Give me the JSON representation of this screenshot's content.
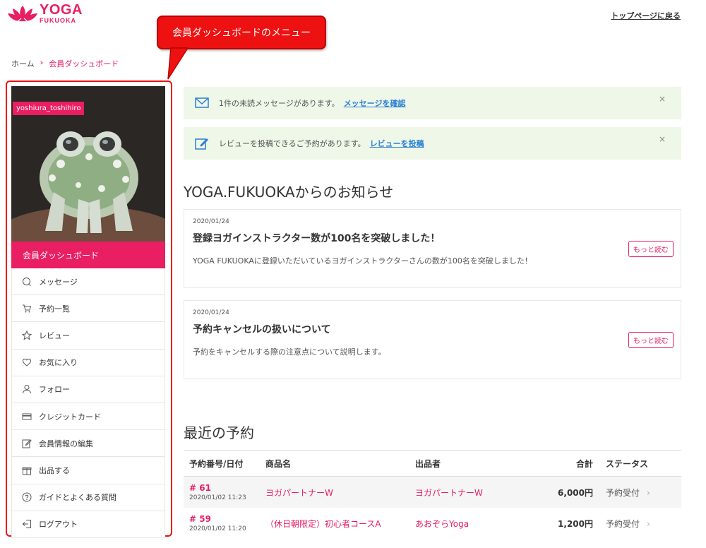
{
  "brand": {
    "name": "YOGA",
    "sub": "FUKUOKA",
    "accent": "#e91e63"
  },
  "header": {
    "back_link": "トップページに戻る"
  },
  "callout": {
    "text": "会員ダッシュボードのメニュー"
  },
  "breadcrumb": [
    "ホーム",
    "会員ダッシュボード"
  ],
  "sidebar": {
    "username": "yoshiura_toshihiro",
    "dashboard_label": "会員ダッシュボード",
    "items": [
      {
        "label": "メッセージ",
        "icon": "message-icon"
      },
      {
        "label": "予約一覧",
        "icon": "cart-icon"
      },
      {
        "label": "レビュー",
        "icon": "star-icon"
      },
      {
        "label": "お気に入り",
        "icon": "heart-icon"
      },
      {
        "label": "フォロー",
        "icon": "user-icon"
      },
      {
        "label": "クレジットカード",
        "icon": "credit-card-icon"
      },
      {
        "label": "会員情報の編集",
        "icon": "edit-icon"
      },
      {
        "label": "出品する",
        "icon": "gift-icon"
      },
      {
        "label": "ガイドとよくある質問",
        "icon": "help-icon"
      },
      {
        "label": "ログアウト",
        "icon": "logout-icon"
      }
    ]
  },
  "alerts": [
    {
      "text": "1件の未読メッセージがあります。",
      "link": "メッセージを確認",
      "icon": "envelope-icon",
      "close": "×"
    },
    {
      "text": "レビューを投稿できるご予約があります。",
      "link": "レビューを投稿",
      "icon": "edit-icon",
      "close": "×"
    }
  ],
  "news": {
    "title": "YOGA.FUKUOKAからのお知らせ",
    "more_label": "もっと読む",
    "items": [
      {
        "date": "2020/01/24",
        "title": "登録ヨガインストラクター数が100名を突破しました！",
        "text": "YOGA FUKUOKAに登録いただいているヨガインストラクターさんの数が100名を突破しました！"
      },
      {
        "date": "2020/01/24",
        "title": "予約キャンセルの扱いについて",
        "text": "予約をキャンセルする際の注意点について説明します。"
      }
    ]
  },
  "reservations": {
    "title": "最近の予約",
    "columns": [
      "予約番号/日付",
      "商品名",
      "出品者",
      "合計",
      "ステータス"
    ],
    "rows": [
      {
        "no": "# 61",
        "date": "2020/01/02 11:23",
        "product": "ヨガパートナーW",
        "seller": "ヨガパートナーW",
        "total": "6,000円",
        "status": "予約受付"
      },
      {
        "no": "# 59",
        "date": "2020/01/02 11:20",
        "product": "（休日朝限定）初心者コースA",
        "seller": "あおぞらYoga",
        "total": "1,200円",
        "status": "予約受付"
      }
    ]
  }
}
